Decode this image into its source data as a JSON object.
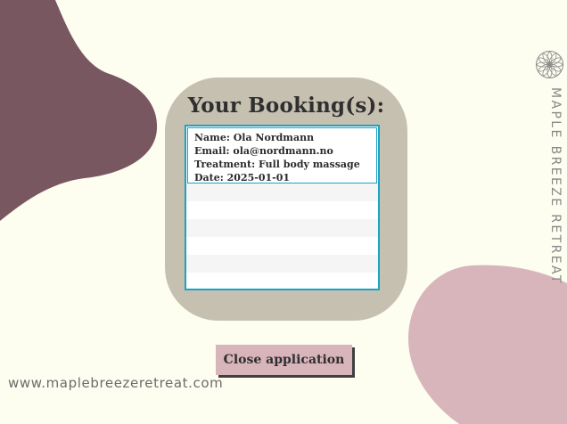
{
  "header": {
    "title": "Your Booking(s):"
  },
  "bookings": [
    {
      "name": "Name: Ola Nordmann",
      "email": "Email: ola@nordmann.no",
      "treatment": "Treatment: Full body massage",
      "date": "Date: 2025-01-01"
    }
  ],
  "actions": {
    "close_label": "Close application"
  },
  "footer": {
    "website": "www.maplebreezeretreat.com"
  },
  "brand": {
    "name": "MAPLE BREEZE RETREAT",
    "logo_icon": "flower-logo-icon"
  },
  "colors": {
    "background": "#fdfdf0",
    "card": "#c6c0b1",
    "accent_border": "#1aa3c4",
    "button": "#d8b4bb",
    "shape_plum": "#795761",
    "shape_pink": "#d7b5bb"
  }
}
